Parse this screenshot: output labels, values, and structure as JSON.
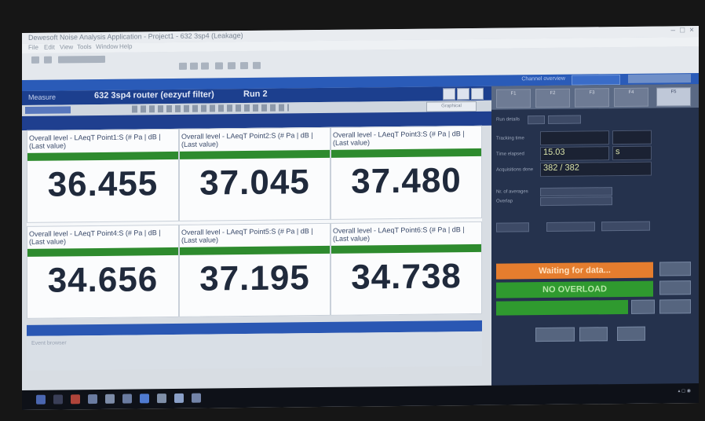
{
  "window": {
    "title": "Dewesoft Noise Analysis Application - Project1 - 632 3sp4 (Leakage)",
    "controls": [
      "–",
      "□",
      "×"
    ]
  },
  "menu": [
    "File",
    "Edit",
    "View",
    "Tools",
    "Window",
    "Help"
  ],
  "project_bar": {
    "selector_label": "Channel overview",
    "selector_value": ""
  },
  "measurement": {
    "label": "Measure",
    "title": "632 3sp4 router (eezyuf filter)",
    "run": "Run 2"
  },
  "subtoolbar": {
    "dropdown": "Graphical"
  },
  "tiles": [
    {
      "header": "Overall level - LAeqT Point1:S (# Pa | dB | (Last value)",
      "value": "36.455"
    },
    {
      "header": "Overall level - LAeqT Point2:S (# Pa | dB | (Last value)",
      "value": "37.045"
    },
    {
      "header": "Overall level - LAeqT Point3:S (# Pa | dB | (Last value)",
      "value": "37.480"
    },
    {
      "header": "Overall level - LAeqT Point4:S (# Pa | dB | (Last value)",
      "value": "34.656"
    },
    {
      "header": "Overall level - LAeqT Point5:S (# Pa | dB | (Last value)",
      "value": "37.195"
    },
    {
      "header": "Overall level - LAeqT Point6:S (# Pa | dB | (Last value)",
      "value": "34.738"
    }
  ],
  "bottom_panel": {
    "title": "Event browser",
    "content": ""
  },
  "right_panel": {
    "tabs": [
      "F1",
      "F2",
      "F3",
      "F4",
      "F5"
    ],
    "rows": [
      {
        "label": "Run details",
        "value": ""
      },
      {
        "label": "Tracking time",
        "value": ""
      },
      {
        "label": "Time elapsed",
        "value": "15.03"
      },
      {
        "label": "Acquisitions done",
        "value": "382 / 382"
      },
      {
        "label": "Nr. of averages",
        "value": ""
      },
      {
        "label": "Overlap",
        "value": ""
      }
    ],
    "elapsed_unit": "s",
    "status_waiting": "Waiting for data...",
    "status_overload": "NO OVERLOAD",
    "action_button": "",
    "side_button": "",
    "bottom_controls": [
      "",
      "",
      ""
    ]
  },
  "colors": {
    "accent_blue": "#2a5bb8",
    "green": "#2e8b2e",
    "orange": "#e57d2e"
  }
}
